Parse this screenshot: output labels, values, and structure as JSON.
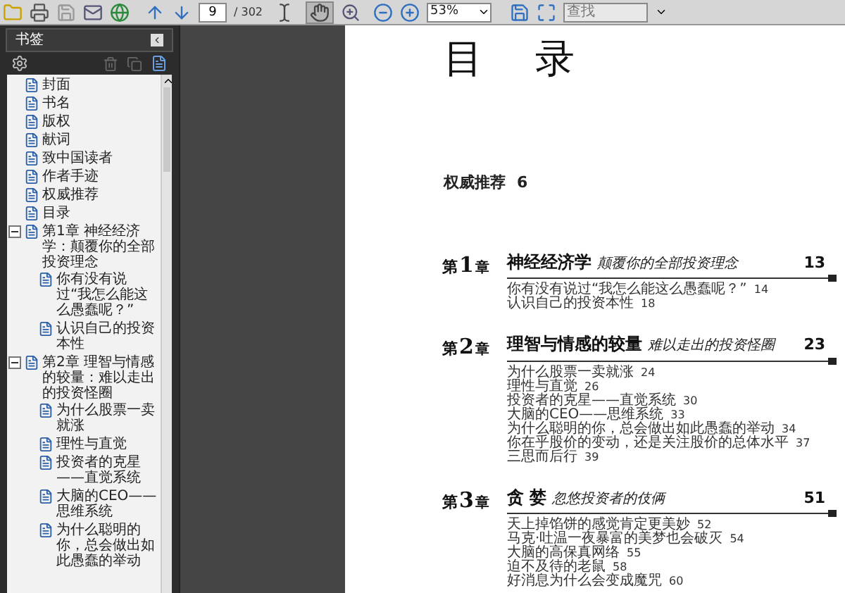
{
  "toolbar": {
    "tools": [
      {
        "kind": "select",
        "selected": false
      },
      {
        "kind": "hand",
        "selected": true
      }
    ],
    "page_value": "9",
    "page_total": "/ 302",
    "zoom": "53%",
    "search_placeholder": "查找"
  },
  "bookmarks": {
    "title": "书签",
    "items": [
      {
        "label": "封面"
      },
      {
        "label": "书名"
      },
      {
        "label": "版权"
      },
      {
        "label": "献词"
      },
      {
        "label": "致中国读者"
      },
      {
        "label": "作者手迹"
      },
      {
        "label": "权威推荐"
      },
      {
        "label": "目录"
      },
      {
        "label": "第1章  神经经济学：颠覆你的全部投资理念",
        "expanded": true,
        "children": [
          {
            "label": "你有没有说过“我怎么能这么愚蠢呢？”"
          },
          {
            "label": "认识自己的投资本性"
          }
        ]
      },
      {
        "label": "第2章  理智与情感的较量：难以走出的投资怪圈",
        "expanded": true,
        "children": [
          {
            "label": "为什么股票一卖就涨"
          },
          {
            "label": "理性与直觉"
          },
          {
            "label": "投资者的克星——直觉系统"
          },
          {
            "label": "大脑的CEO——思维系统"
          },
          {
            "label": "为什么聪明的你，总会做出如此愚蠢的举动"
          }
        ]
      }
    ]
  },
  "page": {
    "title": "目 录",
    "recommend": {
      "title": "权威推荐",
      "page": "6"
    },
    "chapters": [
      {
        "prefix": "第",
        "number": "1",
        "suffix": "章",
        "title": "神经经济学",
        "subtitle": "颠覆你的全部投资理念",
        "page": "13",
        "sections": [
          {
            "title": "你有没有说过“我怎么能这么愚蠢呢？”",
            "page": "14"
          },
          {
            "title": "认识自己的投资本性",
            "page": "18"
          }
        ]
      },
      {
        "prefix": "第",
        "number": "2",
        "suffix": "章",
        "title": "理智与情感的较量",
        "subtitle": "难以走出的投资怪圈",
        "page": "23",
        "sections": [
          {
            "title": "为什么股票一卖就涨",
            "page": "24"
          },
          {
            "title": "理性与直觉",
            "page": "26"
          },
          {
            "title": "投资者的克星——直觉系统",
            "page": "30"
          },
          {
            "title": "大脑的CEO——思维系统",
            "page": "33"
          },
          {
            "title": "为什么聪明的你，总会做出如此愚蠢的举动",
            "page": "34"
          },
          {
            "title": "你在乎股价的变动，还是关注股价的总体水平",
            "page": "37"
          },
          {
            "title": "三思而后行",
            "page": "39"
          }
        ]
      },
      {
        "prefix": "第",
        "number": "3",
        "suffix": "章",
        "title": "贪 婪",
        "subtitle": "忽悠投资者的伎俩",
        "page": "51",
        "sections": [
          {
            "title": "天上掉馅饼的感觉肯定更美妙",
            "page": "52"
          },
          {
            "title": "马克·吐温一夜暴富的美梦也会破灭",
            "page": "54"
          },
          {
            "title": "大脑的高保真网络",
            "page": "55"
          },
          {
            "title": "迫不及待的老鼠",
            "page": "58"
          },
          {
            "title": "好消息为什么会变成魔咒",
            "page": "60"
          }
        ]
      }
    ]
  }
}
